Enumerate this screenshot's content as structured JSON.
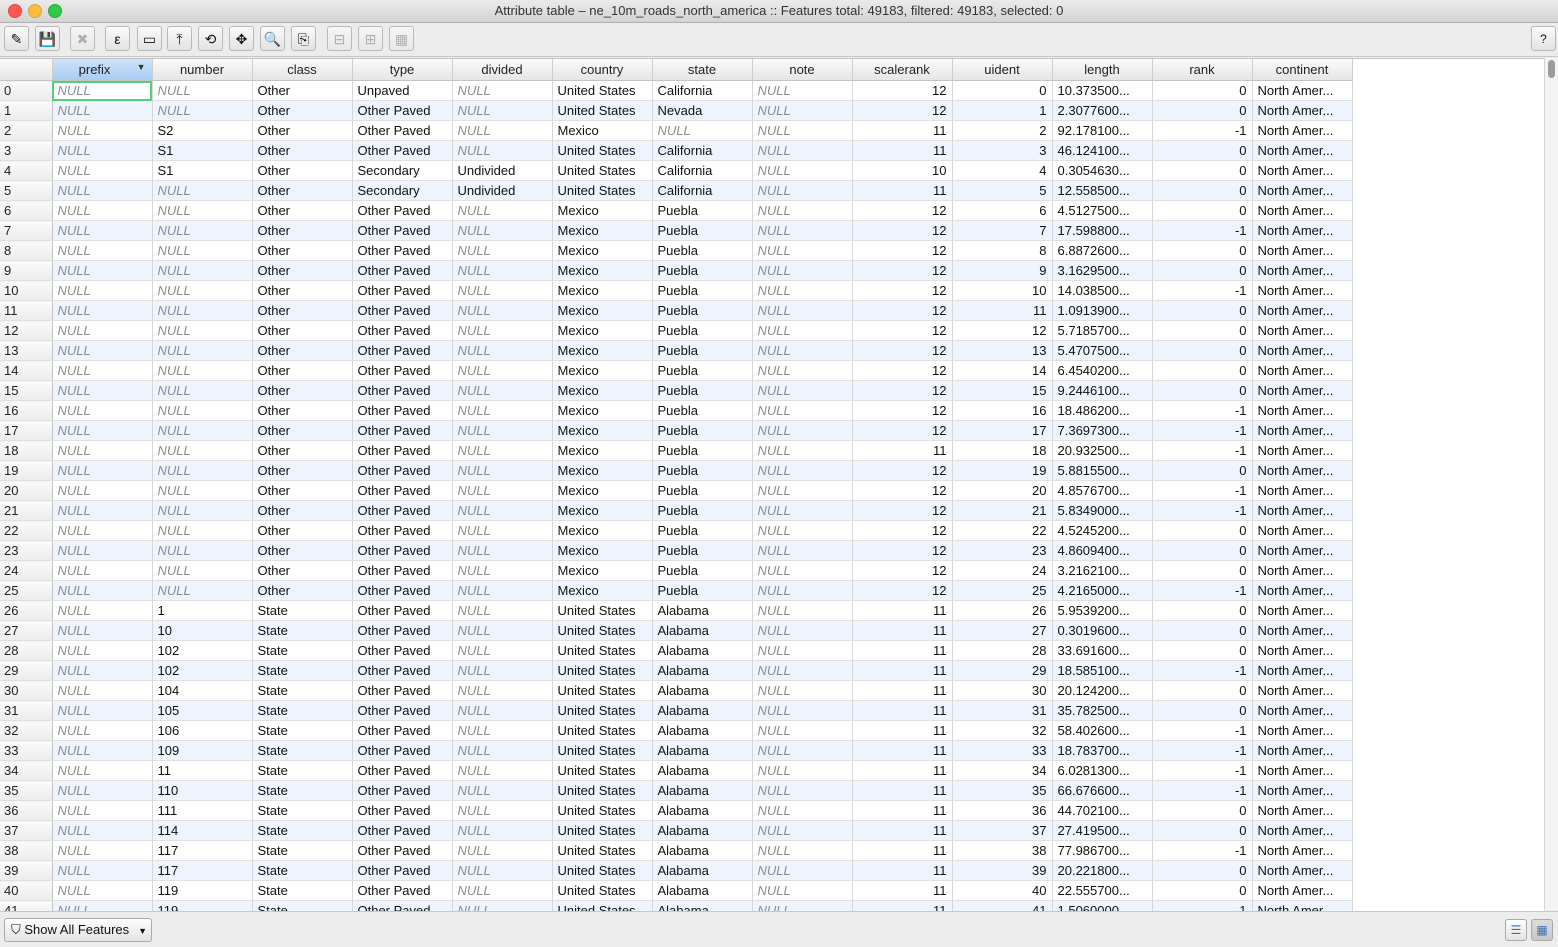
{
  "window": {
    "title": "Attribute table – ne_10m_roads_north_america :: Features total: 49183, filtered: 49183, selected: 0"
  },
  "toolbar": {
    "buttons": [
      {
        "name": "toggle-editing",
        "glyph": "✎",
        "enabled": true
      },
      {
        "name": "save-edits",
        "glyph": "💾",
        "enabled": false
      },
      {
        "name": "delete-selected",
        "glyph": "✖",
        "enabled": false
      },
      {
        "name": "field-calculator-expression",
        "glyph": "ε",
        "enabled": true
      },
      {
        "name": "unselect-all",
        "glyph": "▭",
        "enabled": true
      },
      {
        "name": "move-selection-top",
        "glyph": "⤒",
        "enabled": true
      },
      {
        "name": "invert-selection",
        "glyph": "⟲",
        "enabled": true
      },
      {
        "name": "pan-to-selected",
        "glyph": "✥",
        "enabled": true
      },
      {
        "name": "zoom-to-selected",
        "glyph": "🔍",
        "enabled": true
      },
      {
        "name": "copy-selected",
        "glyph": "⎘",
        "enabled": true
      },
      {
        "name": "delete-column",
        "glyph": "⊟",
        "enabled": false
      },
      {
        "name": "new-column",
        "glyph": "⊞",
        "enabled": false
      },
      {
        "name": "field-calculator",
        "glyph": "▦",
        "enabled": false
      }
    ],
    "help_label": "?"
  },
  "table": {
    "columns": [
      "prefix",
      "number",
      "class",
      "type",
      "divided",
      "country",
      "state",
      "note",
      "scalerank",
      "uident",
      "length",
      "rank",
      "continent"
    ],
    "sorted_column": "prefix",
    "rows": [
      [
        "0",
        "NULL",
        "NULL",
        "Other",
        "Unpaved",
        "NULL",
        "United States",
        "California",
        "NULL",
        "12",
        "0",
        "10.373500...",
        "0",
        "North Amer..."
      ],
      [
        "1",
        "NULL",
        "NULL",
        "Other",
        "Other Paved",
        "NULL",
        "United States",
        "Nevada",
        "NULL",
        "12",
        "1",
        "2.3077600...",
        "0",
        "North Amer..."
      ],
      [
        "2",
        "NULL",
        "S2",
        "Other",
        "Other Paved",
        "NULL",
        "Mexico",
        "NULL",
        "NULL",
        "11",
        "2",
        "92.178100...",
        "-1",
        "North Amer..."
      ],
      [
        "3",
        "NULL",
        "S1",
        "Other",
        "Other Paved",
        "NULL",
        "United States",
        "California",
        "NULL",
        "11",
        "3",
        "46.124100...",
        "0",
        "North Amer..."
      ],
      [
        "4",
        "NULL",
        "S1",
        "Other",
        "Secondary",
        "Undivided",
        "United States",
        "California",
        "NULL",
        "10",
        "4",
        "0.3054630...",
        "0",
        "North Amer..."
      ],
      [
        "5",
        "NULL",
        "NULL",
        "Other",
        "Secondary",
        "Undivided",
        "United States",
        "California",
        "NULL",
        "11",
        "5",
        "12.558500...",
        "0",
        "North Amer..."
      ],
      [
        "6",
        "NULL",
        "NULL",
        "Other",
        "Other Paved",
        "NULL",
        "Mexico",
        "Puebla",
        "NULL",
        "12",
        "6",
        "4.5127500...",
        "0",
        "North Amer..."
      ],
      [
        "7",
        "NULL",
        "NULL",
        "Other",
        "Other Paved",
        "NULL",
        "Mexico",
        "Puebla",
        "NULL",
        "12",
        "7",
        "17.598800...",
        "-1",
        "North Amer..."
      ],
      [
        "8",
        "NULL",
        "NULL",
        "Other",
        "Other Paved",
        "NULL",
        "Mexico",
        "Puebla",
        "NULL",
        "12",
        "8",
        "6.8872600...",
        "0",
        "North Amer..."
      ],
      [
        "9",
        "NULL",
        "NULL",
        "Other",
        "Other Paved",
        "NULL",
        "Mexico",
        "Puebla",
        "NULL",
        "12",
        "9",
        "3.1629500...",
        "0",
        "North Amer..."
      ],
      [
        "10",
        "NULL",
        "NULL",
        "Other",
        "Other Paved",
        "NULL",
        "Mexico",
        "Puebla",
        "NULL",
        "12",
        "10",
        "14.038500...",
        "-1",
        "North Amer..."
      ],
      [
        "11",
        "NULL",
        "NULL",
        "Other",
        "Other Paved",
        "NULL",
        "Mexico",
        "Puebla",
        "NULL",
        "12",
        "11",
        "1.0913900...",
        "0",
        "North Amer..."
      ],
      [
        "12",
        "NULL",
        "NULL",
        "Other",
        "Other Paved",
        "NULL",
        "Mexico",
        "Puebla",
        "NULL",
        "12",
        "12",
        "5.7185700...",
        "0",
        "North Amer..."
      ],
      [
        "13",
        "NULL",
        "NULL",
        "Other",
        "Other Paved",
        "NULL",
        "Mexico",
        "Puebla",
        "NULL",
        "12",
        "13",
        "5.4707500...",
        "0",
        "North Amer..."
      ],
      [
        "14",
        "NULL",
        "NULL",
        "Other",
        "Other Paved",
        "NULL",
        "Mexico",
        "Puebla",
        "NULL",
        "12",
        "14",
        "6.4540200...",
        "0",
        "North Amer..."
      ],
      [
        "15",
        "NULL",
        "NULL",
        "Other",
        "Other Paved",
        "NULL",
        "Mexico",
        "Puebla",
        "NULL",
        "12",
        "15",
        "9.2446100...",
        "0",
        "North Amer..."
      ],
      [
        "16",
        "NULL",
        "NULL",
        "Other",
        "Other Paved",
        "NULL",
        "Mexico",
        "Puebla",
        "NULL",
        "12",
        "16",
        "18.486200...",
        "-1",
        "North Amer..."
      ],
      [
        "17",
        "NULL",
        "NULL",
        "Other",
        "Other Paved",
        "NULL",
        "Mexico",
        "Puebla",
        "NULL",
        "12",
        "17",
        "7.3697300...",
        "-1",
        "North Amer..."
      ],
      [
        "18",
        "NULL",
        "NULL",
        "Other",
        "Other Paved",
        "NULL",
        "Mexico",
        "Puebla",
        "NULL",
        "11",
        "18",
        "20.932500...",
        "-1",
        "North Amer..."
      ],
      [
        "19",
        "NULL",
        "NULL",
        "Other",
        "Other Paved",
        "NULL",
        "Mexico",
        "Puebla",
        "NULL",
        "12",
        "19",
        "5.8815500...",
        "0",
        "North Amer..."
      ],
      [
        "20",
        "NULL",
        "NULL",
        "Other",
        "Other Paved",
        "NULL",
        "Mexico",
        "Puebla",
        "NULL",
        "12",
        "20",
        "4.8576700...",
        "-1",
        "North Amer..."
      ],
      [
        "21",
        "NULL",
        "NULL",
        "Other",
        "Other Paved",
        "NULL",
        "Mexico",
        "Puebla",
        "NULL",
        "12",
        "21",
        "5.8349000...",
        "-1",
        "North Amer..."
      ],
      [
        "22",
        "NULL",
        "NULL",
        "Other",
        "Other Paved",
        "NULL",
        "Mexico",
        "Puebla",
        "NULL",
        "12",
        "22",
        "4.5245200...",
        "0",
        "North Amer..."
      ],
      [
        "23",
        "NULL",
        "NULL",
        "Other",
        "Other Paved",
        "NULL",
        "Mexico",
        "Puebla",
        "NULL",
        "12",
        "23",
        "4.8609400...",
        "0",
        "North Amer..."
      ],
      [
        "24",
        "NULL",
        "NULL",
        "Other",
        "Other Paved",
        "NULL",
        "Mexico",
        "Puebla",
        "NULL",
        "12",
        "24",
        "3.2162100...",
        "0",
        "North Amer..."
      ],
      [
        "25",
        "NULL",
        "NULL",
        "Other",
        "Other Paved",
        "NULL",
        "Mexico",
        "Puebla",
        "NULL",
        "12",
        "25",
        "4.2165000...",
        "-1",
        "North Amer..."
      ],
      [
        "26",
        "NULL",
        "1",
        "State",
        "Other Paved",
        "NULL",
        "United States",
        "Alabama",
        "NULL",
        "11",
        "26",
        "5.9539200...",
        "0",
        "North Amer..."
      ],
      [
        "27",
        "NULL",
        "10",
        "State",
        "Other Paved",
        "NULL",
        "United States",
        "Alabama",
        "NULL",
        "11",
        "27",
        "0.3019600...",
        "0",
        "North Amer..."
      ],
      [
        "28",
        "NULL",
        "102",
        "State",
        "Other Paved",
        "NULL",
        "United States",
        "Alabama",
        "NULL",
        "11",
        "28",
        "33.691600...",
        "0",
        "North Amer..."
      ],
      [
        "29",
        "NULL",
        "102",
        "State",
        "Other Paved",
        "NULL",
        "United States",
        "Alabama",
        "NULL",
        "11",
        "29",
        "18.585100...",
        "-1",
        "North Amer..."
      ],
      [
        "30",
        "NULL",
        "104",
        "State",
        "Other Paved",
        "NULL",
        "United States",
        "Alabama",
        "NULL",
        "11",
        "30",
        "20.124200...",
        "0",
        "North Amer..."
      ],
      [
        "31",
        "NULL",
        "105",
        "State",
        "Other Paved",
        "NULL",
        "United States",
        "Alabama",
        "NULL",
        "11",
        "31",
        "35.782500...",
        "0",
        "North Amer..."
      ],
      [
        "32",
        "NULL",
        "106",
        "State",
        "Other Paved",
        "NULL",
        "United States",
        "Alabama",
        "NULL",
        "11",
        "32",
        "58.402600...",
        "-1",
        "North Amer..."
      ],
      [
        "33",
        "NULL",
        "109",
        "State",
        "Other Paved",
        "NULL",
        "United States",
        "Alabama",
        "NULL",
        "11",
        "33",
        "18.783700...",
        "-1",
        "North Amer..."
      ],
      [
        "34",
        "NULL",
        "11",
        "State",
        "Other Paved",
        "NULL",
        "United States",
        "Alabama",
        "NULL",
        "11",
        "34",
        "6.0281300...",
        "-1",
        "North Amer..."
      ],
      [
        "35",
        "NULL",
        "110",
        "State",
        "Other Paved",
        "NULL",
        "United States",
        "Alabama",
        "NULL",
        "11",
        "35",
        "66.676600...",
        "-1",
        "North Amer..."
      ],
      [
        "36",
        "NULL",
        "111",
        "State",
        "Other Paved",
        "NULL",
        "United States",
        "Alabama",
        "NULL",
        "11",
        "36",
        "44.702100...",
        "0",
        "North Amer..."
      ],
      [
        "37",
        "NULL",
        "114",
        "State",
        "Other Paved",
        "NULL",
        "United States",
        "Alabama",
        "NULL",
        "11",
        "37",
        "27.419500...",
        "0",
        "North Amer..."
      ],
      [
        "38",
        "NULL",
        "117",
        "State",
        "Other Paved",
        "NULL",
        "United States",
        "Alabama",
        "NULL",
        "11",
        "38",
        "77.986700...",
        "-1",
        "North Amer..."
      ],
      [
        "39",
        "NULL",
        "117",
        "State",
        "Other Paved",
        "NULL",
        "United States",
        "Alabama",
        "NULL",
        "11",
        "39",
        "20.221800...",
        "0",
        "North Amer..."
      ],
      [
        "40",
        "NULL",
        "119",
        "State",
        "Other Paved",
        "NULL",
        "United States",
        "Alabama",
        "NULL",
        "11",
        "40",
        "22.555700...",
        "0",
        "North Amer..."
      ],
      [
        "41",
        "NULL",
        "119",
        "State",
        "Other Paved",
        "NULL",
        "United States",
        "Alabama",
        "NULL",
        "11",
        "41",
        "1.5060000...",
        "-1",
        "North Amer..."
      ]
    ]
  },
  "statusbar": {
    "filter_label": "Show All Features",
    "view_buttons": [
      "form-view",
      "table-view"
    ]
  },
  "colors": {
    "selection_header": "#a9cbf3",
    "row_alternate": "#eef4fd",
    "null_text": "#8c8c8c",
    "focus_cell": "#55d07a"
  }
}
